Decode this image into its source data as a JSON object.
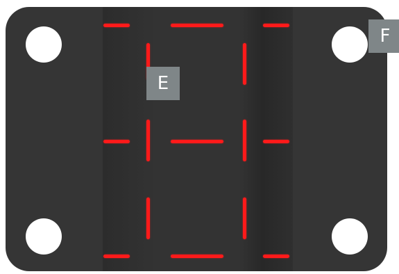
{
  "labels": {
    "e": "E",
    "f": "F"
  },
  "colors": {
    "board": "#353535",
    "segment": "#ff1a1a",
    "tag": "#7f8688",
    "hole": "#ffffff"
  }
}
